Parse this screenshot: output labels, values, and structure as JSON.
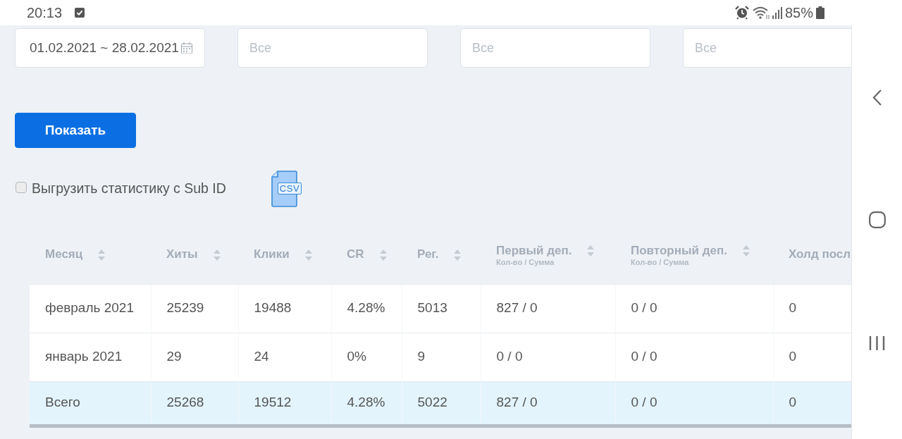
{
  "status_bar": {
    "time": "20:13",
    "battery": "85%"
  },
  "filters": [
    {
      "kind": "date",
      "value": "01.02.2021 ~ 28.02.2021"
    },
    {
      "kind": "select",
      "placeholder": "Все"
    },
    {
      "kind": "select",
      "placeholder": "Все"
    },
    {
      "kind": "select",
      "placeholder": "Все"
    }
  ],
  "show_button": {
    "label": "Показать"
  },
  "export": {
    "label": "Выгрузить статистику с Sub ID",
    "checked": false,
    "file_button": "CSV"
  },
  "table": {
    "columns": [
      {
        "label": "Месяц",
        "sortable": true
      },
      {
        "label": "Хиты",
        "sortable": true
      },
      {
        "label": "Клики",
        "sortable": true
      },
      {
        "label": "CR",
        "sortable": true
      },
      {
        "label": "Рег.",
        "sortable": true
      },
      {
        "label": "Первый деп.",
        "sublabel": "Кол-во / Сумма",
        "sortable": true
      },
      {
        "label": "Повторный деп.",
        "sublabel": "Кол-во / Сумма",
        "sortable": true
      },
      {
        "label": "Холд посл",
        "sortable": false
      }
    ],
    "rows": [
      {
        "kind": "month",
        "cells": [
          "февраль 2021",
          "25239",
          "19488",
          "4.28%",
          "5013",
          "827 / 0",
          "0 / 0",
          "0"
        ]
      },
      {
        "kind": "month",
        "cells": [
          "январь 2021",
          "29",
          "24",
          "0%",
          "9",
          "0 / 0",
          "0 / 0",
          "0"
        ]
      },
      {
        "kind": "total",
        "cells": [
          "Всего",
          "25268",
          "19512",
          "4.28%",
          "5022",
          "827 / 0",
          "0 / 0",
          "0"
        ]
      }
    ]
  }
}
